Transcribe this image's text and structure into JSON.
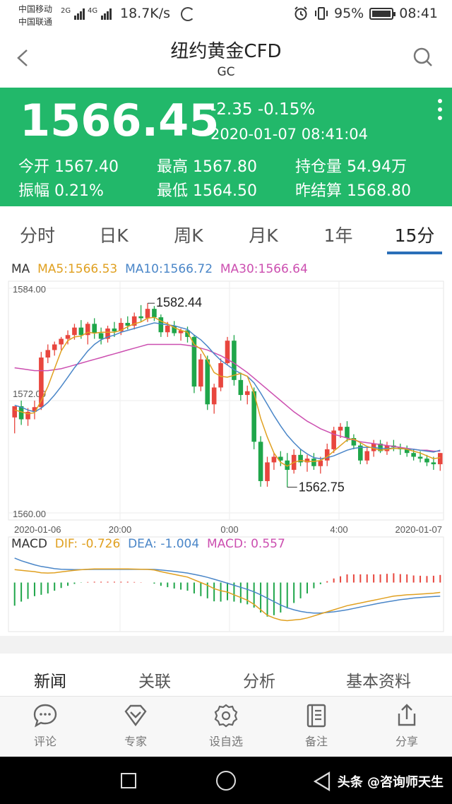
{
  "status_bar": {
    "carrier_1": "中国移动",
    "carrier_2": "中国联通",
    "net_1": "2G",
    "net_2": "4G",
    "speed": "18.7K/s",
    "battery": "95%",
    "time": "08:41"
  },
  "header": {
    "title": "纽约黄金CFD",
    "subtitle": "GC"
  },
  "quote": {
    "price": "1566.45",
    "change": "-2.35 -0.15%",
    "datetime": "2020-01-07 08:41:04",
    "stats": [
      {
        "label": "今开",
        "value": "1567.40"
      },
      {
        "label": "最高",
        "value": "1567.80"
      },
      {
        "label": "持仓量",
        "value": "54.94万"
      },
      {
        "label": "振幅",
        "value": "0.21%"
      },
      {
        "label": "最低",
        "value": "1564.50"
      },
      {
        "label": "昨结算",
        "value": "1568.80"
      }
    ]
  },
  "period_tabs": [
    "分时",
    "日K",
    "周K",
    "月K",
    "1年",
    "15分"
  ],
  "active_period": "15分",
  "ma_legend": {
    "label": "MA",
    "ma5": "MA5:1566.53",
    "ma10": "MA10:1566.72",
    "ma30": "MA30:1566.64"
  },
  "macd_legend": {
    "label": "MACD",
    "dif": "DIF: -0.726",
    "dea": "DEA: -1.004",
    "macd": "MACD: 0.557"
  },
  "colors": {
    "up": "#e8463e",
    "down": "#1fa64a",
    "ma5": "#e0a020",
    "ma10": "#4a86c8",
    "ma30": "#cc4fb0",
    "accent_green": "#22b86a",
    "tab_underline": "#2a6fb8"
  },
  "chart_data": {
    "type": "candlestick",
    "y_ticks": [
      "1584.00",
      "1572.00",
      "1560.00"
    ],
    "ylim": [
      1560,
      1584
    ],
    "x_ticks": [
      "2020-01-06",
      "20:00",
      "0:00",
      "4:00",
      "2020-01-07"
    ],
    "annotations": {
      "high": "1582.44",
      "low": "1562.75"
    },
    "candles": [
      {
        "o": 1570.2,
        "h": 1571.0,
        "l": 1568.5,
        "c": 1571.4
      },
      {
        "o": 1571.4,
        "h": 1572.0,
        "l": 1569.4,
        "c": 1570.0
      },
      {
        "o": 1570.0,
        "h": 1571.2,
        "l": 1569.3,
        "c": 1570.8
      },
      {
        "o": 1570.8,
        "h": 1572.0,
        "l": 1570.0,
        "c": 1571.3
      },
      {
        "o": 1571.3,
        "h": 1577.2,
        "l": 1571.0,
        "c": 1576.6
      },
      {
        "o": 1576.6,
        "h": 1578.0,
        "l": 1576.0,
        "c": 1577.4
      },
      {
        "o": 1577.4,
        "h": 1578.3,
        "l": 1576.8,
        "c": 1578.0
      },
      {
        "o": 1578.0,
        "h": 1578.8,
        "l": 1577.4,
        "c": 1578.6
      },
      {
        "o": 1578.6,
        "h": 1579.5,
        "l": 1578.0,
        "c": 1579.0
      },
      {
        "o": 1579.0,
        "h": 1580.2,
        "l": 1578.5,
        "c": 1579.8
      },
      {
        "o": 1579.8,
        "h": 1580.6,
        "l": 1578.6,
        "c": 1579.0
      },
      {
        "o": 1579.0,
        "h": 1580.4,
        "l": 1578.0,
        "c": 1580.2
      },
      {
        "o": 1580.2,
        "h": 1580.8,
        "l": 1578.6,
        "c": 1579.2
      },
      {
        "o": 1579.2,
        "h": 1579.8,
        "l": 1578.0,
        "c": 1578.6
      },
      {
        "o": 1578.6,
        "h": 1580.0,
        "l": 1578.2,
        "c": 1579.7
      },
      {
        "o": 1579.7,
        "h": 1580.4,
        "l": 1578.8,
        "c": 1579.4
      },
      {
        "o": 1579.4,
        "h": 1580.8,
        "l": 1579.0,
        "c": 1580.3
      },
      {
        "o": 1580.3,
        "h": 1581.0,
        "l": 1579.6,
        "c": 1580.0
      },
      {
        "o": 1580.0,
        "h": 1581.4,
        "l": 1579.6,
        "c": 1581.0
      },
      {
        "o": 1581.0,
        "h": 1582.2,
        "l": 1580.4,
        "c": 1580.8
      },
      {
        "o": 1580.8,
        "h": 1582.4,
        "l": 1580.4,
        "c": 1581.8
      },
      {
        "o": 1581.8,
        "h": 1582.1,
        "l": 1580.5,
        "c": 1580.9
      },
      {
        "o": 1580.9,
        "h": 1581.2,
        "l": 1578.8,
        "c": 1579.3
      },
      {
        "o": 1579.3,
        "h": 1580.4,
        "l": 1578.8,
        "c": 1580.0
      },
      {
        "o": 1580.0,
        "h": 1580.5,
        "l": 1578.9,
        "c": 1579.2
      },
      {
        "o": 1579.2,
        "h": 1579.7,
        "l": 1578.4,
        "c": 1579.5
      },
      {
        "o": 1579.5,
        "h": 1579.9,
        "l": 1578.2,
        "c": 1578.8
      },
      {
        "o": 1578.8,
        "h": 1579.0,
        "l": 1572.8,
        "c": 1573.5
      },
      {
        "o": 1573.5,
        "h": 1577.0,
        "l": 1573.0,
        "c": 1576.4
      },
      {
        "o": 1576.4,
        "h": 1576.8,
        "l": 1571.0,
        "c": 1571.6
      },
      {
        "o": 1571.6,
        "h": 1573.8,
        "l": 1570.6,
        "c": 1573.4
      },
      {
        "o": 1573.4,
        "h": 1576.5,
        "l": 1573.0,
        "c": 1576.0
      },
      {
        "o": 1576.0,
        "h": 1578.8,
        "l": 1575.8,
        "c": 1578.4
      },
      {
        "o": 1578.4,
        "h": 1579.0,
        "l": 1573.6,
        "c": 1574.2
      },
      {
        "o": 1574.2,
        "h": 1575.0,
        "l": 1572.0,
        "c": 1572.6
      },
      {
        "o": 1572.6,
        "h": 1573.6,
        "l": 1571.6,
        "c": 1573.0
      },
      {
        "o": 1573.0,
        "h": 1573.4,
        "l": 1566.8,
        "c": 1567.6
      },
      {
        "o": 1567.6,
        "h": 1568.2,
        "l": 1562.8,
        "c": 1563.4
      },
      {
        "o": 1563.4,
        "h": 1566.0,
        "l": 1562.8,
        "c": 1565.4
      },
      {
        "o": 1565.4,
        "h": 1566.4,
        "l": 1564.6,
        "c": 1566.0
      },
      {
        "o": 1566.0,
        "h": 1566.6,
        "l": 1565.0,
        "c": 1565.6
      },
      {
        "o": 1565.6,
        "h": 1566.4,
        "l": 1562.75,
        "c": 1564.6
      },
      {
        "o": 1564.6,
        "h": 1566.8,
        "l": 1564.2,
        "c": 1566.2
      },
      {
        "o": 1566.2,
        "h": 1566.8,
        "l": 1565.0,
        "c": 1565.4
      },
      {
        "o": 1565.4,
        "h": 1566.2,
        "l": 1564.4,
        "c": 1565.8
      },
      {
        "o": 1565.8,
        "h": 1566.4,
        "l": 1564.6,
        "c": 1565.0
      },
      {
        "o": 1565.0,
        "h": 1566.0,
        "l": 1564.2,
        "c": 1565.6
      },
      {
        "o": 1565.6,
        "h": 1567.4,
        "l": 1565.0,
        "c": 1566.8
      },
      {
        "o": 1566.8,
        "h": 1569.2,
        "l": 1566.4,
        "c": 1568.8
      },
      {
        "o": 1568.8,
        "h": 1569.6,
        "l": 1568.0,
        "c": 1569.2
      },
      {
        "o": 1569.2,
        "h": 1569.8,
        "l": 1567.6,
        "c": 1568.0
      },
      {
        "o": 1568.0,
        "h": 1568.4,
        "l": 1566.8,
        "c": 1567.2
      },
      {
        "o": 1567.2,
        "h": 1567.6,
        "l": 1565.2,
        "c": 1565.6
      },
      {
        "o": 1565.6,
        "h": 1567.0,
        "l": 1565.2,
        "c": 1566.6
      },
      {
        "o": 1566.6,
        "h": 1567.8,
        "l": 1566.0,
        "c": 1567.4
      },
      {
        "o": 1567.4,
        "h": 1567.8,
        "l": 1566.4,
        "c": 1566.6
      },
      {
        "o": 1566.6,
        "h": 1567.6,
        "l": 1566.2,
        "c": 1567.2
      },
      {
        "o": 1567.2,
        "h": 1567.8,
        "l": 1566.6,
        "c": 1567.0
      },
      {
        "o": 1567.0,
        "h": 1567.4,
        "l": 1566.2,
        "c": 1566.8
      },
      {
        "o": 1566.8,
        "h": 1567.2,
        "l": 1566.0,
        "c": 1566.4
      },
      {
        "o": 1566.4,
        "h": 1566.8,
        "l": 1565.6,
        "c": 1566.0
      },
      {
        "o": 1566.0,
        "h": 1566.6,
        "l": 1565.4,
        "c": 1565.8
      },
      {
        "o": 1565.8,
        "h": 1566.2,
        "l": 1565.0,
        "c": 1565.4
      },
      {
        "o": 1565.4,
        "h": 1566.0,
        "l": 1564.6,
        "c": 1565.2
      },
      {
        "o": 1565.2,
        "h": 1566.4,
        "l": 1564.5,
        "c": 1566.4
      }
    ],
    "ma5": [
      1571.0,
      1570.8,
      1570.6,
      1570.7,
      1572.0,
      1573.5,
      1575.4,
      1577.3,
      1578.4,
      1578.8,
      1578.9,
      1579.3,
      1579.2,
      1579.3,
      1579.3,
      1579.3,
      1579.5,
      1579.9,
      1580.2,
      1580.4,
      1580.8,
      1580.9,
      1580.5,
      1580.2,
      1579.8,
      1579.5,
      1579.3,
      1578.0,
      1577.5,
      1576.3,
      1575.0,
      1574.6,
      1574.5,
      1574.7,
      1574.9,
      1574.6,
      1572.8,
      1570.1,
      1568.1,
      1566.4,
      1565.4,
      1565.0,
      1565.4,
      1565.6,
      1565.5,
      1565.5,
      1565.6,
      1566.0,
      1566.6,
      1567.2,
      1567.8,
      1567.9,
      1567.5,
      1567.1,
      1566.9,
      1566.7,
      1566.8,
      1566.9,
      1566.9,
      1566.8,
      1566.6,
      1566.4,
      1566.1,
      1565.8,
      1565.9
    ],
    "ma10": [
      1571.5,
      1571.3,
      1571.0,
      1570.8,
      1571.2,
      1571.8,
      1572.6,
      1573.5,
      1574.5,
      1575.5,
      1576.4,
      1577.3,
      1578.0,
      1578.5,
      1578.8,
      1579.0,
      1579.3,
      1579.5,
      1579.7,
      1579.9,
      1580.1,
      1580.3,
      1580.2,
      1580.1,
      1580.0,
      1579.8,
      1579.6,
      1579.0,
      1578.5,
      1577.8,
      1577.0,
      1576.3,
      1575.8,
      1575.3,
      1574.9,
      1574.6,
      1573.9,
      1572.8,
      1571.6,
      1570.4,
      1569.3,
      1568.3,
      1567.5,
      1566.8,
      1566.3,
      1565.9,
      1565.8,
      1565.9,
      1566.1,
      1566.4,
      1566.7,
      1566.9,
      1567.0,
      1567.0,
      1567.0,
      1566.9,
      1566.9,
      1566.9,
      1566.9,
      1566.8,
      1566.8,
      1566.7,
      1566.6,
      1566.5,
      1566.7
    ],
    "ma30": [
      1575.5,
      1575.4,
      1575.3,
      1575.2,
      1575.2,
      1575.2,
      1575.3,
      1575.4,
      1575.6,
      1575.8,
      1576.0,
      1576.2,
      1576.4,
      1576.6,
      1576.8,
      1577.0,
      1577.2,
      1577.4,
      1577.6,
      1577.8,
      1578.0,
      1578.0,
      1578.0,
      1578.0,
      1578.0,
      1578.0,
      1577.9,
      1577.8,
      1577.6,
      1577.4,
      1577.1,
      1576.8,
      1576.4,
      1576.0,
      1575.5,
      1575.0,
      1574.4,
      1573.8,
      1573.2,
      1572.6,
      1572.0,
      1571.4,
      1570.8,
      1570.3,
      1569.8,
      1569.4,
      1569.0,
      1568.7,
      1568.4,
      1568.2,
      1568.0,
      1567.8,
      1567.6,
      1567.5,
      1567.4,
      1567.3,
      1567.2,
      1567.1,
      1567.0,
      1566.9,
      1566.8,
      1566.7,
      1566.7,
      1566.6,
      1566.6
    ],
    "macd": {
      "ylim": [
        -3.5,
        2.0
      ],
      "dif": [
        0.95,
        0.9,
        0.85,
        0.8,
        0.72,
        0.7,
        0.72,
        0.78,
        0.84,
        0.9,
        0.94,
        0.98,
        1.0,
        1.0,
        1.0,
        1.0,
        1.0,
        1.0,
        0.99,
        0.98,
        0.97,
        0.92,
        0.8,
        0.7,
        0.6,
        0.5,
        0.4,
        0.2,
        0.0,
        -0.2,
        -0.45,
        -0.6,
        -0.7,
        -0.9,
        -1.1,
        -1.3,
        -1.6,
        -2.0,
        -2.4,
        -2.6,
        -2.75,
        -2.8,
        -2.75,
        -2.7,
        -2.6,
        -2.45,
        -2.3,
        -2.15,
        -2.0,
        -1.85,
        -1.7,
        -1.6,
        -1.5,
        -1.4,
        -1.3,
        -1.2,
        -1.1,
        -1.0,
        -0.95,
        -0.9,
        -0.88,
        -0.85,
        -0.82,
        -0.78,
        -0.726
      ],
      "dea": [
        1.8,
        1.6,
        1.45,
        1.3,
        1.18,
        1.1,
        1.02,
        0.98,
        0.96,
        0.95,
        0.95,
        0.96,
        0.97,
        0.97,
        0.97,
        0.97,
        0.97,
        0.97,
        0.97,
        0.97,
        0.97,
        0.96,
        0.92,
        0.87,
        0.82,
        0.76,
        0.7,
        0.6,
        0.5,
        0.38,
        0.24,
        0.1,
        -0.05,
        -0.2,
        -0.35,
        -0.5,
        -0.68,
        -0.9,
        -1.15,
        -1.4,
        -1.65,
        -1.85,
        -2.0,
        -2.12,
        -2.2,
        -2.24,
        -2.24,
        -2.2,
        -2.15,
        -2.08,
        -2.0,
        -1.9,
        -1.8,
        -1.7,
        -1.6,
        -1.5,
        -1.42,
        -1.34,
        -1.26,
        -1.2,
        -1.14,
        -1.1,
        -1.06,
        -1.03,
        -1.004
      ],
      "hist": [
        -1.7,
        -1.4,
        -1.2,
        -1.0,
        -0.9,
        -0.8,
        -0.6,
        -0.4,
        -0.24,
        -0.1,
        -0.02,
        0.04,
        0.06,
        0.06,
        0.06,
        0.06,
        0.06,
        0.06,
        0.04,
        0.02,
        0.0,
        -0.08,
        -0.24,
        -0.34,
        -0.44,
        -0.52,
        -0.6,
        -0.8,
        -1.0,
        -1.16,
        -1.38,
        -1.4,
        -1.3,
        -1.4,
        -1.5,
        -1.6,
        -1.84,
        -2.2,
        -2.5,
        -2.4,
        -2.2,
        -1.9,
        -1.5,
        -1.16,
        -0.8,
        -0.42,
        -0.12,
        0.1,
        0.3,
        0.46,
        0.6,
        0.6,
        0.6,
        0.6,
        0.6,
        0.6,
        0.64,
        0.68,
        0.62,
        0.6,
        0.52,
        0.5,
        0.48,
        0.5,
        0.557
      ]
    }
  },
  "news_tabs": [
    "新闻",
    "关联",
    "分析",
    "基本资料"
  ],
  "toolbar": [
    {
      "label": "评论",
      "icon": "comment-icon"
    },
    {
      "label": "专家",
      "icon": "diamond-icon"
    },
    {
      "label": "设自选",
      "icon": "gear-icon"
    },
    {
      "label": "备注",
      "icon": "note-icon"
    },
    {
      "label": "分享",
      "icon": "share-icon"
    }
  ],
  "watermark": "头条 @咨询师天生"
}
